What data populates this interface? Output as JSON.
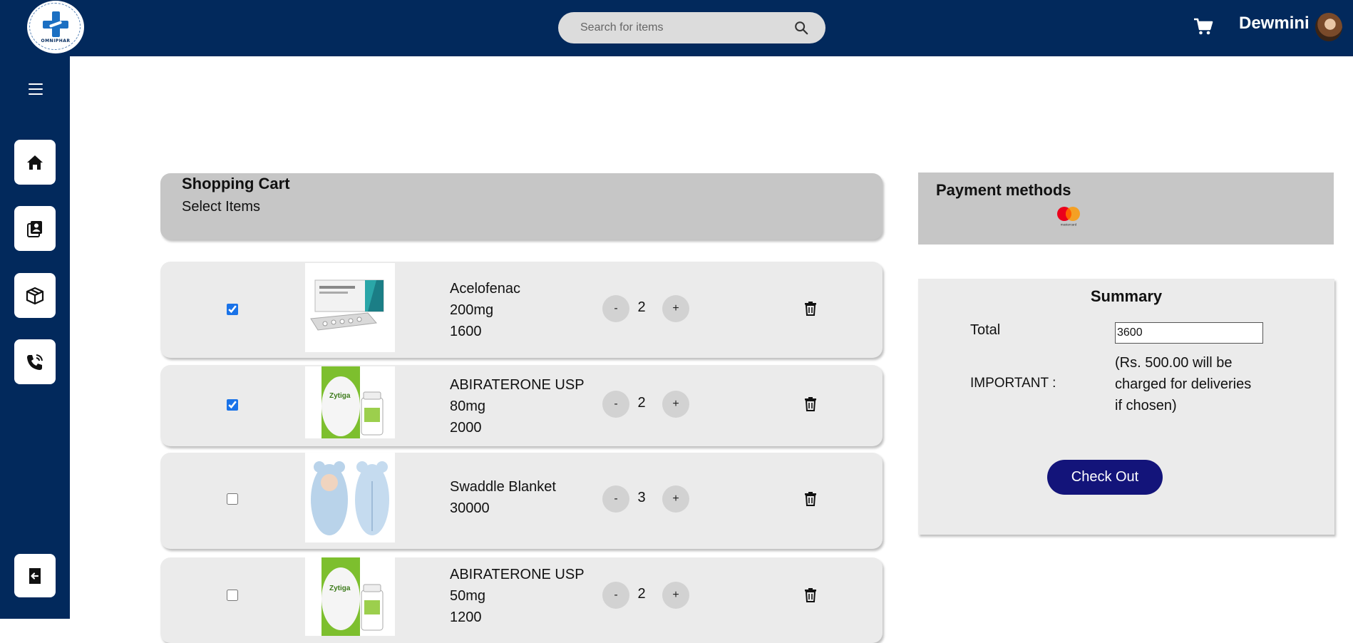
{
  "header": {
    "logo_text": "OMNIPHAR",
    "search_placeholder": "Search for items",
    "username": "Dewmini"
  },
  "sidebar": {
    "items": [
      {
        "name": "home",
        "icon": "home-icon"
      },
      {
        "name": "contacts",
        "icon": "contact-book-icon"
      },
      {
        "name": "orders",
        "icon": "box-icon"
      },
      {
        "name": "call",
        "icon": "phone-icon"
      },
      {
        "name": "logout",
        "icon": "logout-icon"
      }
    ]
  },
  "cart": {
    "title": "Shopping Cart",
    "subtitle": "Select Items",
    "items": [
      {
        "checked": true,
        "name": "Acelofenac",
        "dose": "200mg",
        "price": "1600",
        "qty": "2",
        "image": "acelofenac-pack"
      },
      {
        "checked": true,
        "name": "ABIRATERONE USP",
        "dose": "80mg",
        "price": "2000",
        "qty": "2",
        "image": "zytiga-bottle"
      },
      {
        "checked": false,
        "name": "Swaddle Blanket",
        "price": "30000",
        "qty": "3",
        "image": "swaddle-blanket"
      },
      {
        "checked": false,
        "name": "ABIRATERONE USP",
        "dose": "50mg",
        "price": "1200",
        "qty": "2",
        "image": "zytiga-bottle"
      }
    ],
    "minus_label": "-",
    "plus_label": "+"
  },
  "payment": {
    "title": "Payment methods",
    "card_label": "mastercard"
  },
  "summary": {
    "title": "Summary",
    "total_label": "Total",
    "total_value": "3600",
    "important_label": "IMPORTANT :",
    "important_note": "(Rs. 500.00 will be charged for deliveries if chosen)",
    "checkout_label": "Check Out"
  },
  "colors": {
    "navy": "#02295c",
    "checkout": "#13147a",
    "panel_grey": "#c6c6c6",
    "item_grey": "#ebebeb"
  }
}
